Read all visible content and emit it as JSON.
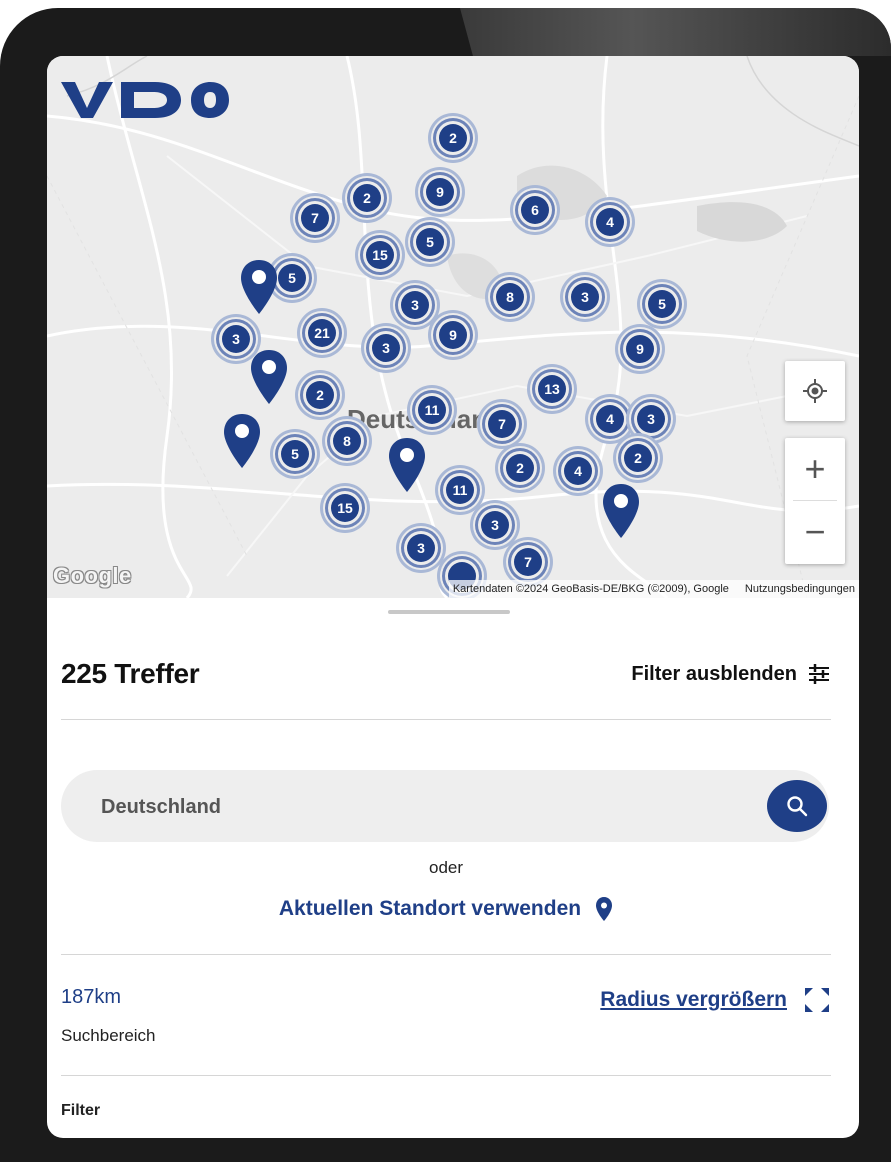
{
  "brand": {
    "logo_text": "VDO",
    "accent_color": "#1f3f87"
  },
  "map": {
    "country_label": "Deutschland",
    "google_logo": "Google",
    "attribution": "Kartendaten ©2024 GeoBasis-DE/BKG (©2009), Google",
    "terms": "Nutzungsbedingungen",
    "controls": {
      "locate_icon": "crosshair-icon",
      "zoom_in": "+",
      "zoom_out": "−"
    },
    "clusters": [
      "2",
      "7",
      "2",
      "9",
      "6",
      "4",
      "15",
      "5",
      "5",
      "3",
      "8",
      "3",
      "5",
      "3",
      "21",
      "3",
      "9",
      "9",
      "2",
      "11",
      "13",
      "4",
      "3",
      "8",
      "7",
      "5",
      "2",
      "4",
      "2",
      "15",
      "11",
      "3",
      "3",
      "7"
    ],
    "pins": 5
  },
  "results": {
    "count_text": "225 Treffer",
    "hide_filter_label": "Filter ausblenden"
  },
  "search": {
    "value": "",
    "placeholder": "Deutschland",
    "button_icon": "search-icon"
  },
  "alt": {
    "or_text": "oder",
    "use_location_label": "Aktuellen Standort verwenden"
  },
  "radius": {
    "value": "187km",
    "label": "Suchbereich",
    "increase_label": "Radius vergrößern"
  },
  "filter": {
    "label": "Filter"
  }
}
